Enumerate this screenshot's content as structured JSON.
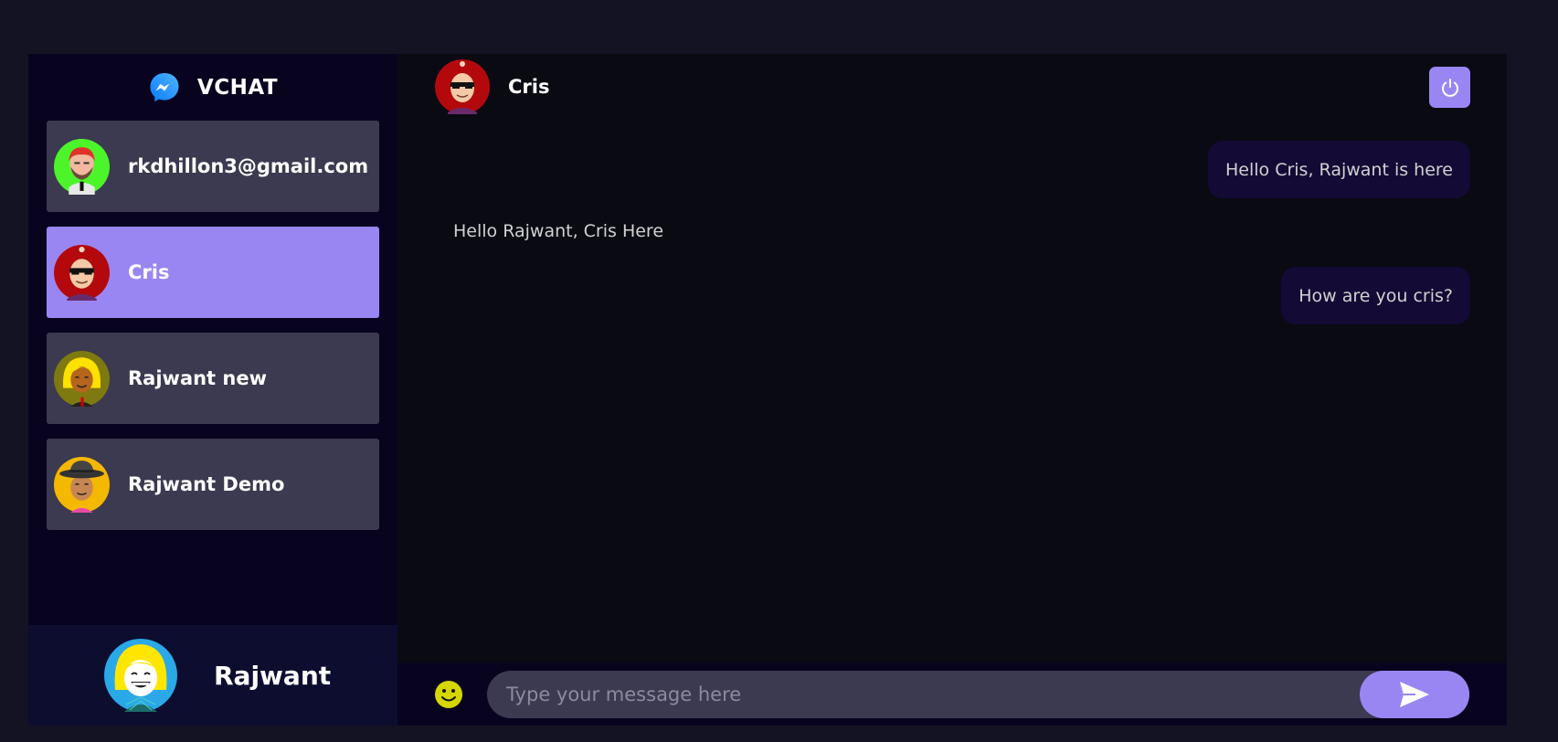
{
  "brand": {
    "name": "VCHAT",
    "logo_icon": "messenger-icon"
  },
  "contacts": [
    {
      "name": "rkdhillon3@gmail.com",
      "avatar": "red-hair-bearded-avatar",
      "active": false
    },
    {
      "name": "Cris",
      "avatar": "sunglasses-bald-avatar",
      "active": true
    },
    {
      "name": "Rajwant new",
      "avatar": "blonde-woman-avatar",
      "active": false
    },
    {
      "name": "Rajwant Demo",
      "avatar": "fedora-man-avatar",
      "active": false
    }
  ],
  "current_user": {
    "name": "Rajwant",
    "avatar": "laughing-blonde-avatar"
  },
  "chat": {
    "header_name": "Cris",
    "header_avatar": "sunglasses-bald-avatar",
    "logout_icon": "power-icon",
    "messages": [
      {
        "direction": "sent",
        "text": "Hello Cris, Rajwant is here"
      },
      {
        "direction": "received",
        "text": "Hello Rajwant, Cris Here"
      },
      {
        "direction": "sent",
        "text": "How are you cris?"
      }
    ]
  },
  "composer": {
    "placeholder": "Type your message here",
    "value": "",
    "emoji_icon": "smiley-icon",
    "send_icon": "send-icon"
  },
  "colors": {
    "page_bg": "#131324",
    "sidebar_bg": "#080420",
    "accent": "#9a86f3",
    "contact_bg": "#3b3a50",
    "sent_bubble": "#130a35"
  }
}
